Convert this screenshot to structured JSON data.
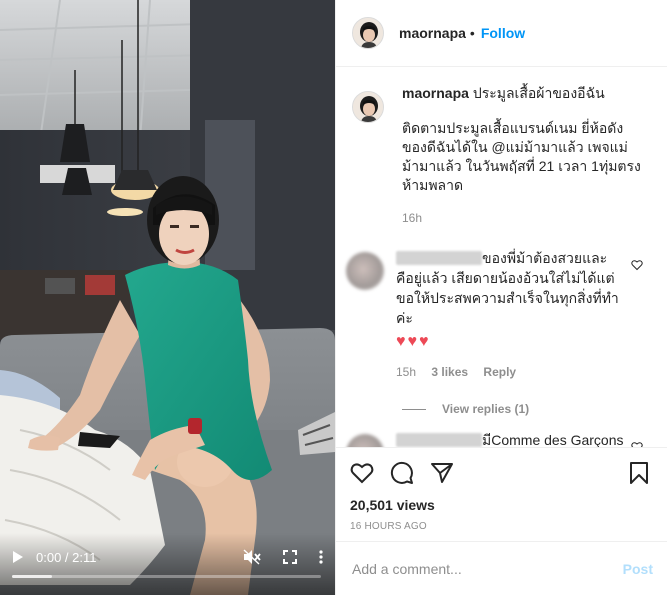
{
  "header": {
    "username": "maornapa",
    "separator": "•",
    "follow_label": "Follow"
  },
  "caption": {
    "username": "maornapa",
    "title": "ประมูลเสื้อผ้าของอีฉัน",
    "text": "ติดตามประมูลเสื้อแบรนด์เนม ยี่ห้อดังของดีฉันได้ใน @แม่ม้ามาแล้ว เพจแม่ม้ามาแล้ว ในวันพฤัสที่ 21 เวลา 1ทุ่มตรง ห้ามพลาด",
    "time": "16h"
  },
  "comments": [
    {
      "text": "ของพี่ม้าต้องสวยและคือยู่แล้ว เสียดายน้องอ้วนใส่ไม่ได้แต่ขอให้ประสพความสำเร็จในทุกสิ่งที่ทำค่ะ",
      "emoji": "♥♥♥",
      "time": "15h",
      "likes": "3 likes",
      "reply_label": "Reply",
      "view_replies": "View replies (1)"
    },
    {
      "text": "มีComme des Garçons ร่วมประมูลด้วยมั้ยคะ😅"
    }
  ],
  "actions": {
    "views": "20,501 views",
    "time_ago": "16 HOURS AGO"
  },
  "add_comment": {
    "placeholder": "Add a comment...",
    "post_label": "Post"
  },
  "video": {
    "time": "0:00 / 2:11",
    "progress": 0.13
  },
  "icons": [
    "play-icon",
    "mute-icon",
    "fullscreen-icon",
    "more-vert-icon",
    "heart-icon",
    "comment-icon",
    "share-icon",
    "bookmark-icon"
  ]
}
